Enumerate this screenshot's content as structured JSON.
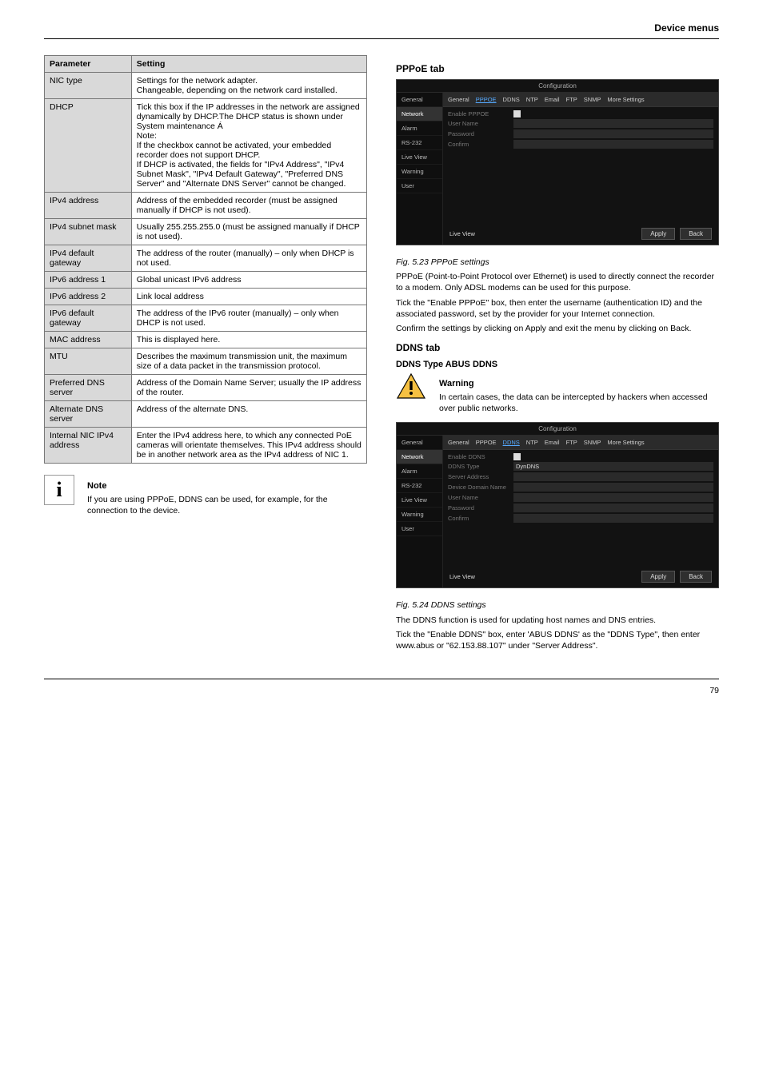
{
  "section_header_right": "Device menus",
  "params_table": {
    "headers": [
      "Parameter",
      "Setting"
    ],
    "rows": [
      [
        "NIC type",
        "Settings for the network adapter.\nChangeable, depending on the network card installed."
      ],
      [
        "DHCP",
        "Tick this box if the IP addresses in the network are assigned dynamically by DHCP.The DHCP status is shown under System maintenance Á\nNote:\nIf the checkbox cannot be activated, your embedded recorder does not support DHCP.\nIf DHCP is activated, the fields for \"IPv4 Address\", \"IPv4 Subnet Mask\", \"IPv4 Default Gateway\", \"Preferred DNS Server\" and \"Alternate DNS Server\" cannot be changed."
      ],
      [
        "IPv4 address",
        "Address of the embedded recorder (must be assigned manually if DHCP is not used)."
      ],
      [
        "IPv4 subnet mask",
        "Usually 255.255.255.0 (must be assigned manually if DHCP is not used)."
      ],
      [
        "IPv4 default gateway",
        "The address of the router (manually) – only when DHCP is not used."
      ],
      [
        "IPv6 address 1",
        "Global unicast IPv6 address"
      ],
      [
        "IPv6 address 2",
        "Link local address"
      ],
      [
        "IPv6 default gateway",
        "The address of the IPv6 router (manually) – only when DHCP is not used."
      ],
      [
        "MAC address",
        "This is displayed here."
      ],
      [
        "MTU",
        "Describes the maximum transmission unit, the maximum size of a data packet in the transmission protocol."
      ],
      [
        "Preferred DNS server",
        "Address of the Domain Name Server; usually the IP address of the router."
      ],
      [
        "Alternate DNS server",
        "Address of the alternate DNS."
      ],
      [
        "Internal NIC IPv4 address",
        "Enter the IPv4 address here, to which any connected PoE cameras will orientate themselves. This IPv4 address should be in another network area as the IPv4 address of NIC 1."
      ]
    ]
  },
  "note_text": "If you are using PPPoE, DDNS can be used, for example, for the connection to the device.",
  "pppoe": {
    "heading": "PPPoE tab",
    "fig_ref": "Fig. 5.23 PPPoE settings",
    "para1": "PPPoE (Point-to-Point Protocol over Ethernet) is used to directly connect the recorder to a modem. Only ADSL modems can be used for this purpose.",
    "para2": "Tick the \"Enable PPPoE\" box, then enter the username (authentication ID) and the associated password, set by the provider for your Internet connection.",
    "para3": "Confirm the settings by clicking on Apply and exit the menu by clicking on Back."
  },
  "ddns": {
    "heading": "DDNS tab",
    "subhead": "DDNS Type ABUS DDNS",
    "warning_para": "In certain cases, the data can be intercepted by hackers when accessed over public networks.",
    "fig_ref": "Fig. 5.24 DDNS settings",
    "para1": "The DDNS function is used for updating host names and DNS entries.",
    "para2": "Tick the \"Enable DDNS\" box, enter 'ABUS DDNS' as the \"DDNS Type\", then enter www.abus or \"62.153.88.107\" under \"Server Address\"."
  },
  "ui_shot_pppoe": {
    "title": "Configuration",
    "sidebar": [
      "General",
      "Network",
      "Alarm",
      "RS-232",
      "Live View",
      "Warning",
      "User"
    ],
    "tabs": [
      "General",
      "PPPOE",
      "DDNS",
      "NTP",
      "Email",
      "FTP",
      "SNMP",
      "More Settings"
    ],
    "active_tab": 1,
    "rows": [
      {
        "label": "Enable PPPOE",
        "checkbox": true
      },
      {
        "label": "User Name",
        "val": ""
      },
      {
        "label": "Password",
        "val": ""
      },
      {
        "label": "Confirm",
        "val": ""
      }
    ],
    "footer_left": "Live View",
    "btn_apply": "Apply",
    "btn_back": "Back"
  },
  "ui_shot_ddns": {
    "title": "Configuration",
    "sidebar": [
      "General",
      "Network",
      "Alarm",
      "RS-232",
      "Live View",
      "Warning",
      "User"
    ],
    "tabs": [
      "General",
      "PPPOE",
      "DDNS",
      "NTP",
      "Email",
      "FTP",
      "SNMP",
      "More Settings"
    ],
    "active_tab": 2,
    "rows": [
      {
        "label": "Enable DDNS",
        "checkbox": true
      },
      {
        "label": "DDNS Type",
        "val": "DynDNS"
      },
      {
        "label": "Server Address",
        "val": ""
      },
      {
        "label": "Device Domain Name",
        "val": ""
      },
      {
        "label": "User Name",
        "val": ""
      },
      {
        "label": "Password",
        "val": ""
      },
      {
        "label": "Confirm",
        "val": ""
      }
    ],
    "footer_left": "Live View",
    "btn_apply": "Apply",
    "btn_back": "Back"
  },
  "page_number": "79"
}
